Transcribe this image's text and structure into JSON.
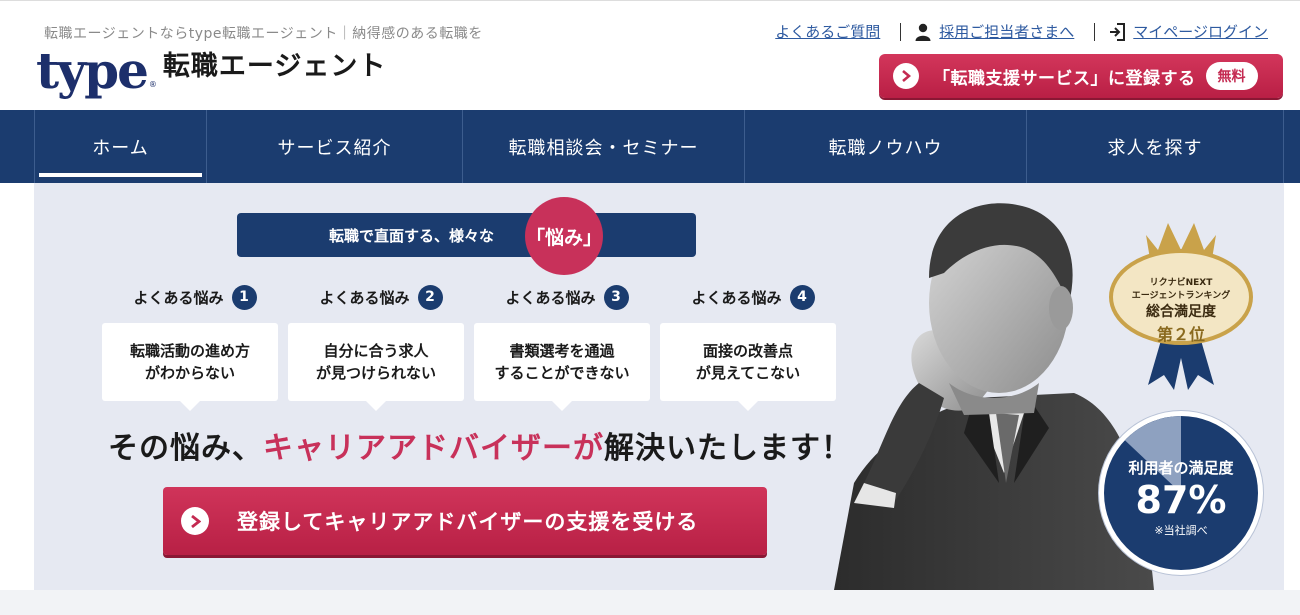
{
  "header": {
    "tagline": "転職エージェントならtype転職エージェント｜納得感のある転職を",
    "logo_main": "type",
    "logo_reg": "®",
    "logo_sub": "転職エージェント",
    "links": {
      "faq": "よくあるご質問",
      "employers": "採用ご担当者さまへ",
      "mypage": "マイページログイン"
    },
    "register_button": {
      "label": "「転職支援サービス」に登録する",
      "badge": "無料"
    }
  },
  "nav": {
    "items": [
      {
        "label": "ホーム",
        "active": true
      },
      {
        "label": "サービス紹介",
        "active": false
      },
      {
        "label": "転職相談会・セミナー",
        "active": false
      },
      {
        "label": "転職ノウハウ",
        "active": false
      },
      {
        "label": "求人を探す",
        "active": false
      }
    ]
  },
  "hero": {
    "bar_text": "転職で直面する、様々な",
    "bar_highlight": "「悩み」",
    "worries": [
      {
        "head": "よくある悩み",
        "num": "1",
        "line1": "転職活動の進め方",
        "line2": "がわからない"
      },
      {
        "head": "よくある悩み",
        "num": "2",
        "line1": "自分に合う求人",
        "line2": "が見つけられない"
      },
      {
        "head": "よくある悩み",
        "num": "3",
        "line1": "書類選考を通過",
        "line2": "することができない"
      },
      {
        "head": "よくある悩み",
        "num": "4",
        "line1": "面接の改善点",
        "line2": "が見えてこない"
      }
    ],
    "headline_pre": "その悩み、",
    "headline_em": "キャリアアドバイザーが",
    "headline_post": "解決いたします！",
    "cta_label": "登録してキャリアアドバイザーの支援を受ける",
    "ranking": {
      "line1": "リクナビNEXT",
      "line2": "エージェントランキング",
      "line3": "総合満足度",
      "line4": "第２位"
    },
    "satisfaction": {
      "label": "利用者の満足度",
      "value": "87%",
      "fraction": 0.87,
      "note": "※当社調べ"
    }
  },
  "colors": {
    "navy": "#1b3c6f",
    "accent": "#c8315a",
    "link": "#2e5aa0"
  }
}
